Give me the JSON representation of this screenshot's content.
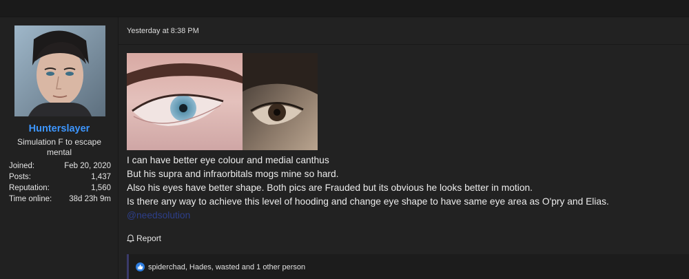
{
  "user": {
    "username": "Hunterslayer",
    "title": "Simulation F to escape mental",
    "stats": [
      {
        "label": "Joined:",
        "value": "Feb 20, 2020"
      },
      {
        "label": "Posts:",
        "value": "1,437"
      },
      {
        "label": "Reputation:",
        "value": "1,560"
      },
      {
        "label": "Time online:",
        "value": "38d 23h 9m"
      }
    ]
  },
  "post": {
    "date": "Yesterday at 8:38 PM",
    "lines": [
      "I can have better eye colour and medial canthus",
      "But his supra and infraorbitals mogs mine so hard.",
      "Also his eyes have better shape. Both pics are Frauded but its obvious he looks better in motion.",
      "Is there any way to achieve this level of hooding and change eye shape to have same eye area as O'pry and Elias."
    ],
    "mention": "@needsolution",
    "report_label": "Report",
    "reactions_text": "spiderchad, Hades, wasted and 1 other person"
  },
  "colors": {
    "username": "#3d96ff",
    "mention": "#2d3f8a",
    "like_badge": "#2d7de0"
  },
  "icons": {
    "report": "bell-icon",
    "reaction": "like-icon"
  }
}
